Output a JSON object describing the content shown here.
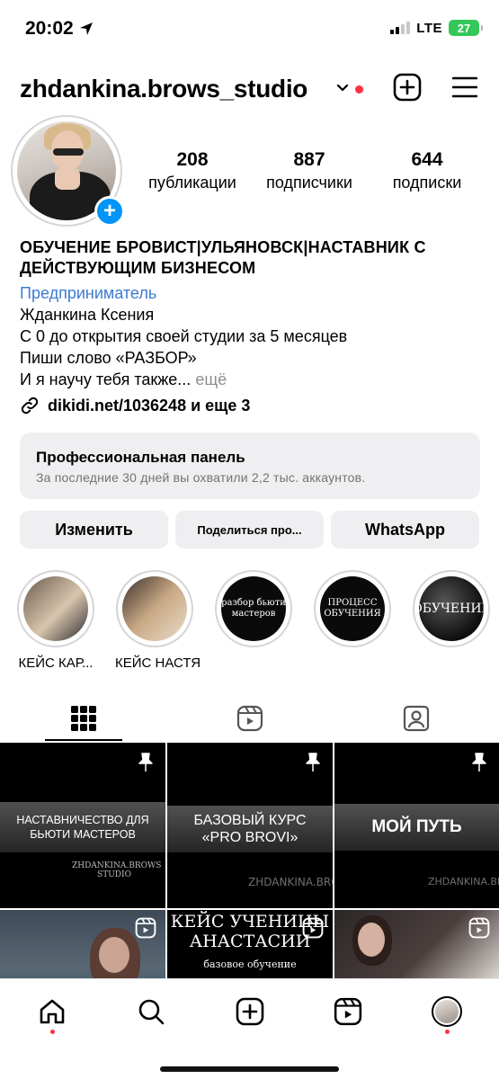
{
  "status_bar": {
    "time": "20:02",
    "network": "LTE",
    "battery": "27"
  },
  "header": {
    "username": "zhdankina.brows_studio",
    "icons": [
      "chevron-down-icon",
      "new-post-icon",
      "menu-icon"
    ],
    "notification_color": "#ff3040"
  },
  "profile": {
    "stats": [
      {
        "value": "208",
        "label": "публикации"
      },
      {
        "value": "887",
        "label": "подписчики"
      },
      {
        "value": "644",
        "label": "подписки"
      }
    ],
    "add_story_badge": "+"
  },
  "bio": {
    "name_line1": "ОБУЧЕНИЕ БРОВИСТ|УЛЬЯНОВСК|НАСТАВНИК С",
    "name_line2": "ДЕЙСТВУЮЩИМ БИЗНЕСОМ",
    "category": "Предприниматель",
    "lines": [
      "Жданкина Ксения",
      "С 0 до открытия своей студии за 5 месяцев",
      "Пиши слово «РАЗБОР»"
    ],
    "truncated_line": "И я научу тебя также...",
    "more": "ещё",
    "link": "dikidi.net/1036248 и еще 3"
  },
  "pro_panel": {
    "title": "Профессиональная панель",
    "subtitle": "За последние 30 дней вы охватили 2,2 тыс. аккаунтов."
  },
  "buttons": {
    "edit": "Изменить",
    "share": "Поделиться про...",
    "whatsapp": "WhatsApp"
  },
  "highlights": [
    {
      "label": "КЕЙС КАР...",
      "cover_text": ""
    },
    {
      "label": "КЕЙС НАСТЯ",
      "cover_text": ""
    },
    {
      "label": "",
      "cover_text": "разбор бьюти мастеров"
    },
    {
      "label": "",
      "cover_text": "ПРОЦЕСС ОБУЧЕНИЯ"
    },
    {
      "label": "",
      "cover_text": "ОБУЧЕНИЕ"
    }
  ],
  "tabs": [
    "grid-icon",
    "reels-icon",
    "tagged-icon"
  ],
  "posts": [
    {
      "caption": "НАСТАВНИЧЕСТВО ДЛЯ БЬЮТИ МАСТЕРОВ",
      "watermark": "ZHDANKINA.BROWS STUDIO",
      "pinned": true
    },
    {
      "caption": "БАЗОВЫЙ КУРС «PRO BROVI»",
      "watermark": "ZHDANKINA.BROWS",
      "pinned": true
    },
    {
      "caption": "МОЙ ПУТЬ",
      "watermark": "ZHDANKINA.BROWS",
      "pinned": true
    },
    {
      "caption": "",
      "reel": true
    },
    {
      "caption": "КЕЙС УЧЕНИЦЫ АНАСТАСИИ",
      "subcaption": "базовое обучение",
      "reel": true
    },
    {
      "caption": "",
      "reel": true
    }
  ],
  "bottom_nav": [
    "home-icon",
    "search-icon",
    "create-icon",
    "reels-icon",
    "profile-avatar"
  ]
}
